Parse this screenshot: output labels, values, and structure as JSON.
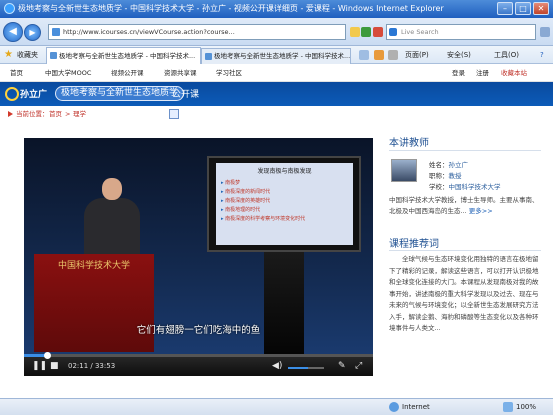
{
  "window": {
    "title": "极地考察与全新世生态地质学 - 中国科学技术大学 - 孙立广 - 视频公开课详细页 - 爱课程 - Windows Internet Explorer",
    "min": "–",
    "max": "□",
    "close": "✕"
  },
  "addressbar": {
    "url": "http://www.icourses.cn/viewVCourse.action?course...",
    "search_placeholder": "Live Search"
  },
  "favorites": {
    "label": "收藏夹",
    "tabs": [
      {
        "label": "极地考察与全新世生态地质学 - 中国科学技术..."
      },
      {
        "label": "极地考察与全新世生态地质学 - 中国科学技术..."
      }
    ],
    "commands": {
      "page": "页面(P)",
      "safety": "安全(S)",
      "tools": "工具(O)",
      "help": "?"
    }
  },
  "site_nav": {
    "items": [
      "首页",
      "中国大学MOOC",
      "视频公开课",
      "资源共享课",
      "学习社区"
    ],
    "login": "登录",
    "register": "注册",
    "favorite": "收藏本站"
  },
  "banner": {
    "teacher": "孙立广",
    "course_title": "极地考察与全新世生态地质学",
    "type": "公开课"
  },
  "breadcrumb": {
    "prefix": "当前位置：",
    "home": "首页",
    "sep": ">",
    "category": "理学"
  },
  "video": {
    "podium_text": "中国科学技术大学",
    "slide_title": "发现南极与南极发现",
    "slide_items": [
      "南极梦",
      "南极深度的新闻时代",
      "南极深度的英雄时代",
      "南极地理的时代",
      "南极深度的科学考察与环境变化时代"
    ],
    "subtitle": "它们有翅膀一它们吃海中的鱼",
    "time": "02:11 / 33:53",
    "progress": 0.065,
    "volume": 0.55
  },
  "right_panel": {
    "teacher_heading": "本讲教师",
    "name_label": "姓名：",
    "name": "孙立广",
    "title_label": "职称：",
    "title": "教授",
    "school_label": "学校：",
    "school": "中国科学技术大学",
    "description": "中国科学技术大学教授，博士生导师。主要从事南、北极及中国西海岛的生态...",
    "more": "更多>>",
    "recommend_heading": "课程推荐词",
    "recommend_text": "全球气候与生态环境变化用独特的语言在极地留下了精彩的记录，解读这些语言，可以打开认识极地和全球变化连接的大门。本课程从发现南极对我的故事开始，讲述南极的重大科学发现以及过去、现在与未来的气候与环境变化；以全新世生态发展研究方法入手，解读企鹅、海豹和磷酸等生态变化以及各种环境事件与人类文..."
  },
  "statusbar": {
    "zone": "Internet",
    "zoom": "100%"
  }
}
